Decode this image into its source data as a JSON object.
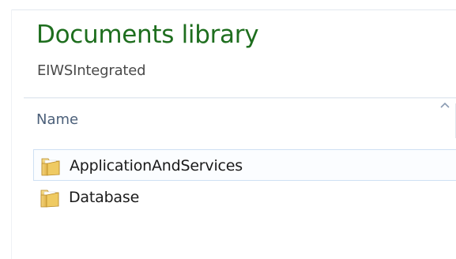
{
  "library": {
    "title": "Documents library",
    "subtitle": "EIWSIntegrated"
  },
  "columns": {
    "name_label": "Name",
    "sort_icon": "sort-ascending-icon"
  },
  "items": [
    {
      "label": "ApplicationAndServices",
      "icon": "folder-icon",
      "selected": true
    },
    {
      "label": "Database",
      "icon": "folder-icon",
      "selected": false
    }
  ],
  "colors": {
    "title": "#1e6e1e",
    "selection_border": "#cfe0f3",
    "folder": "#e8c25a"
  }
}
